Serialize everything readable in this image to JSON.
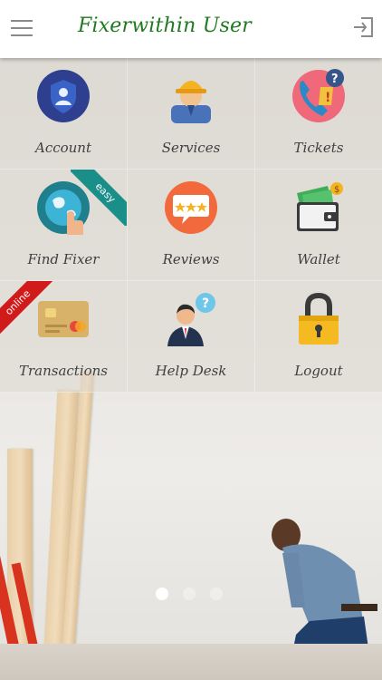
{
  "header": {
    "title": "Fixerwithin User",
    "menu_icon": "hamburger-menu-icon",
    "logout_icon": "exit-door-icon"
  },
  "tiles": [
    {
      "label": "Account",
      "icon": "account-shield-icon"
    },
    {
      "label": "Services",
      "icon": "worker-helmet-icon"
    },
    {
      "label": "Tickets",
      "icon": "phone-support-icon"
    },
    {
      "label": "Find Fixer",
      "icon": "globe-touch-icon",
      "ribbon": "easy"
    },
    {
      "label": "Reviews",
      "icon": "rating-stars-icon"
    },
    {
      "label": "Wallet",
      "icon": "wallet-money-icon"
    },
    {
      "label": "Transactions",
      "icon": "credit-card-icon",
      "ribbon": "online"
    },
    {
      "label": "Help Desk",
      "icon": "help-person-icon"
    },
    {
      "label": "Logout",
      "icon": "padlock-icon"
    }
  ],
  "carousel": {
    "pages": 3,
    "active": 1
  },
  "colors": {
    "title": "#1f7a1f",
    "ribbon_easy": "#1a8f8a",
    "ribbon_online": "#d11a1a"
  }
}
